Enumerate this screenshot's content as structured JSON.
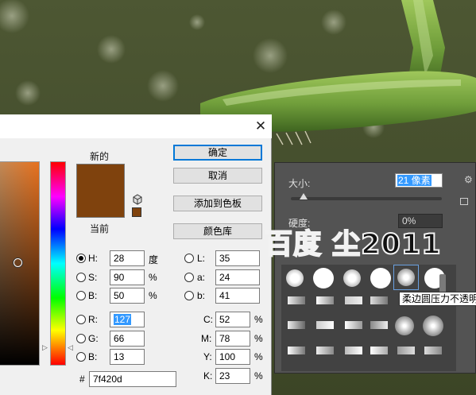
{
  "dialog": {
    "close_glyph": "✕",
    "label_new": "新的",
    "label_current": "当前",
    "buttons": {
      "ok": "确定",
      "cancel": "取消",
      "add_to_swatches": "添加到色板",
      "color_libraries": "颜色库"
    },
    "hsb": {
      "h_label": "H:",
      "h_value": "28",
      "h_unit": "度",
      "s_label": "S:",
      "s_value": "90",
      "s_unit": "%",
      "b_label": "B:",
      "b_value": "50",
      "b_unit": "%"
    },
    "rgb": {
      "r_label": "R:",
      "r_value": "127",
      "g_label": "G:",
      "g_value": "66",
      "b_label": "B:",
      "b_value": "13"
    },
    "lab": {
      "l_label": "L:",
      "l_value": "35",
      "a_label": "a:",
      "a_value": "24",
      "b_label": "b:",
      "b_value": "41"
    },
    "cmyk": {
      "c_label": "C:",
      "c_value": "52",
      "c_unit": "%",
      "m_label": "M:",
      "m_value": "78",
      "m_unit": "%",
      "y_label": "Y:",
      "y_value": "100",
      "y_unit": "%",
      "k_label": "K:",
      "k_value": "23",
      "k_unit": "%"
    },
    "hex_label": "#",
    "hex_value": "7f420d",
    "colors": {
      "new": "#7f420d",
      "current": "#7f420d"
    }
  },
  "brush_panel": {
    "size_label": "大小:",
    "size_value": "21 像素",
    "hardness_label": "硬度:",
    "hardness_value": "0%",
    "tooltip": "柔边圆压力不透明"
  },
  "watermark": "百度 尘2011"
}
